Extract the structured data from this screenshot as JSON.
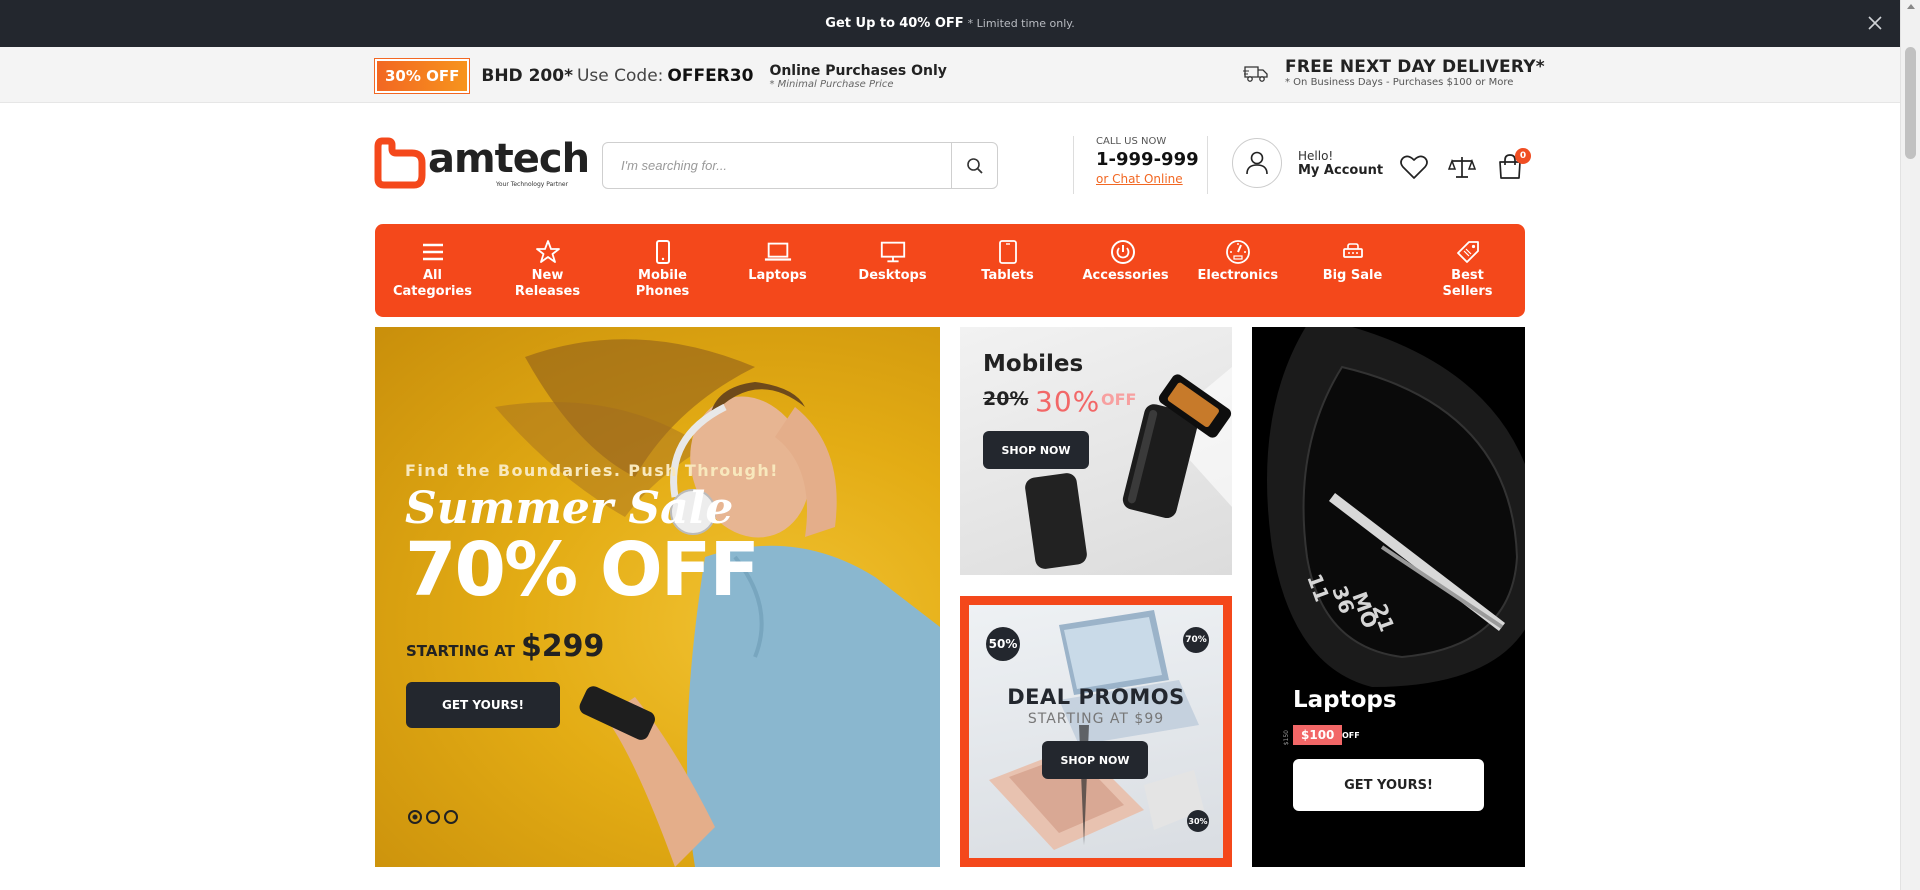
{
  "announcement": {
    "prefix": "Get Up to",
    "highlight": "40% OFF",
    "suffix": "* Limited time only."
  },
  "promo": {
    "badge": "30% OFF",
    "amount": "BHD 200*",
    "use_code": "Use Code:",
    "code": "OFFER30",
    "online_title": "Online Purchases Only",
    "online_note": "* Minimal Purchase Price",
    "delivery_title": "FREE NEXT DAY DELIVERY*",
    "delivery_note": "* On Business Days - Purchases $100 or More"
  },
  "brand": {
    "name": "amtech",
    "tagline": "Your Technology Partner",
    "color": "#f4481b"
  },
  "search": {
    "placeholder": "I'm searching for..."
  },
  "contact": {
    "label": "CALL US NOW",
    "phone": "1-999-999",
    "chat": "or Chat Online"
  },
  "account": {
    "greeting": "Hello!",
    "label": "My Account"
  },
  "cart": {
    "count": "0"
  },
  "categories": [
    {
      "label": "All Categories",
      "icon": "menu-icon"
    },
    {
      "label": "New Releases",
      "icon": "star-icon"
    },
    {
      "label": "Mobile Phones",
      "icon": "mobile-icon"
    },
    {
      "label": "Laptops",
      "icon": "laptop-icon"
    },
    {
      "label": "Desktops",
      "icon": "desktop-icon"
    },
    {
      "label": "Tablets",
      "icon": "tablet-icon"
    },
    {
      "label": "Accessories",
      "icon": "power-icon"
    },
    {
      "label": "Electronics",
      "icon": "gauge-icon"
    },
    {
      "label": "Big Sale",
      "icon": "sale-icon"
    },
    {
      "label": "Best Sellers",
      "icon": "tag-icon"
    }
  ],
  "hero": {
    "kicker": "Find the Boundaries. Push Through!",
    "script": "Summer Sale",
    "headline": "70% OFF",
    "starting": "STARTING AT",
    "price": "$299",
    "cta": "GET YOURS!",
    "slides": 3,
    "active_slide": 1
  },
  "mobiles_card": {
    "title": "Mobiles",
    "old": "20%",
    "new": "30%",
    "off": "OFF",
    "cta": "SHOP NOW"
  },
  "deals_card": {
    "badge_50": "50%",
    "badge_70": "70%",
    "badge_30": "30%",
    "title": "DEAL PROMOS",
    "subtitle": "STARTING AT $99",
    "cta": "SHOP NOW"
  },
  "laptops_card": {
    "title": "Laptops",
    "was": "$150",
    "price": "$100",
    "off": "OFF",
    "cta": "GET YOURS!",
    "watch_time": [
      "11",
      "36",
      "MO",
      "21"
    ]
  }
}
